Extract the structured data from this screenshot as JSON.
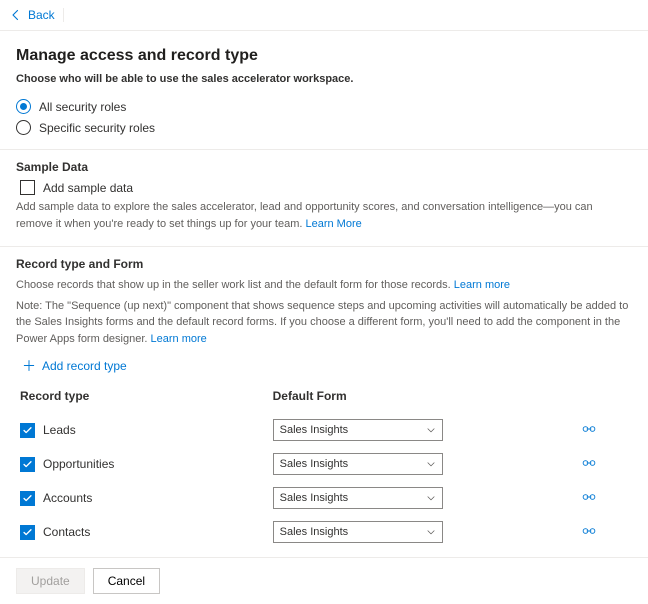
{
  "back_label": "Back",
  "title": "Manage access and record type",
  "subtitle": "Choose who will be able to use the sales accelerator workspace.",
  "roles": {
    "all": {
      "label": "All security roles",
      "selected": true
    },
    "specific": {
      "label": "Specific security roles",
      "selected": false
    }
  },
  "sample": {
    "section_title": "Sample Data",
    "checkbox_label": "Add sample data",
    "checked": false,
    "help": "Add sample data to explore the sales accelerator, lead and opportunity scores, and conversation intelligence—you can remove it when you're ready to set things up for your team. ",
    "learn_more": "Learn More"
  },
  "recordtype": {
    "section_title": "Record type and Form",
    "help1": "Choose records that show up in the seller work list and the default form for those records. ",
    "learn_more1": "Learn more",
    "help2": "Note: The \"Sequence (up next)\" component that shows sequence steps and upcoming activities will automatically be added to the Sales Insights forms and the default record forms. If you choose a different form, you'll need to add the component in the Power Apps form designer. ",
    "learn_more2": "Learn more",
    "add_label": "Add record type",
    "col_record": "Record type",
    "col_form": "Default Form",
    "rows": [
      {
        "label": "Leads",
        "checked": true,
        "form": "Sales Insights"
      },
      {
        "label": "Opportunities",
        "checked": true,
        "form": "Sales Insights"
      },
      {
        "label": "Accounts",
        "checked": true,
        "form": "Sales Insights"
      },
      {
        "label": "Contacts",
        "checked": true,
        "form": "Sales Insights"
      }
    ]
  },
  "footer": {
    "update": "Update",
    "cancel": "Cancel"
  }
}
